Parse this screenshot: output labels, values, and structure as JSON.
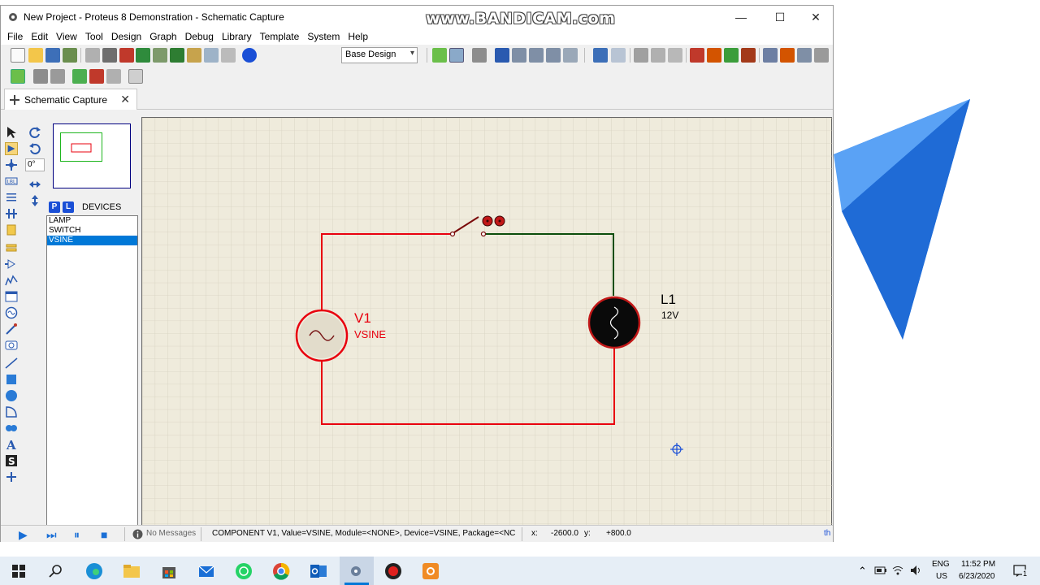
{
  "window": {
    "title": "New Project - Proteus 8 Demonstration - Schematic Capture",
    "minimize": "—",
    "maximize": "☐",
    "close": "✕"
  },
  "watermark": "www.BANDICAM.com",
  "menu": [
    "File",
    "Edit",
    "View",
    "Tool",
    "Design",
    "Graph",
    "Debug",
    "Library",
    "Template",
    "System",
    "Help"
  ],
  "toolbar": {
    "design_select": "Base Design"
  },
  "tab": {
    "label": "Schematic Capture",
    "close": "✕"
  },
  "rotation": {
    "angle": "0°"
  },
  "devices": {
    "p_button": "P",
    "l_button": "L",
    "title": "DEVICES",
    "items": [
      "LAMP",
      "SWITCH",
      "VSINE"
    ],
    "selected": "VSINE"
  },
  "schematic": {
    "source_ref": "V1",
    "source_value": "VSINE",
    "lamp_ref": "L1",
    "lamp_value": "12V"
  },
  "status": {
    "messages": "No Messages",
    "info": "COMPONENT V1, Value=VSINE, Module=<NONE>, Device=VSINE, Package=<NC",
    "x_label": "x:",
    "x_value": "-2600.0",
    "y_label": "y:",
    "y_value": "+800.0",
    "units": "th"
  },
  "taskbar": {
    "lang_top": "ENG",
    "lang_bottom": "US",
    "time": "11:52 PM",
    "date": "6/23/2020",
    "notifications": "1"
  },
  "colors": {
    "wire_red": "#e8000e",
    "wire_green": "#0b4d0b",
    "canvas_bg": "#efebdc",
    "grid": "#d6d1c0",
    "accent": "#0078d7"
  }
}
